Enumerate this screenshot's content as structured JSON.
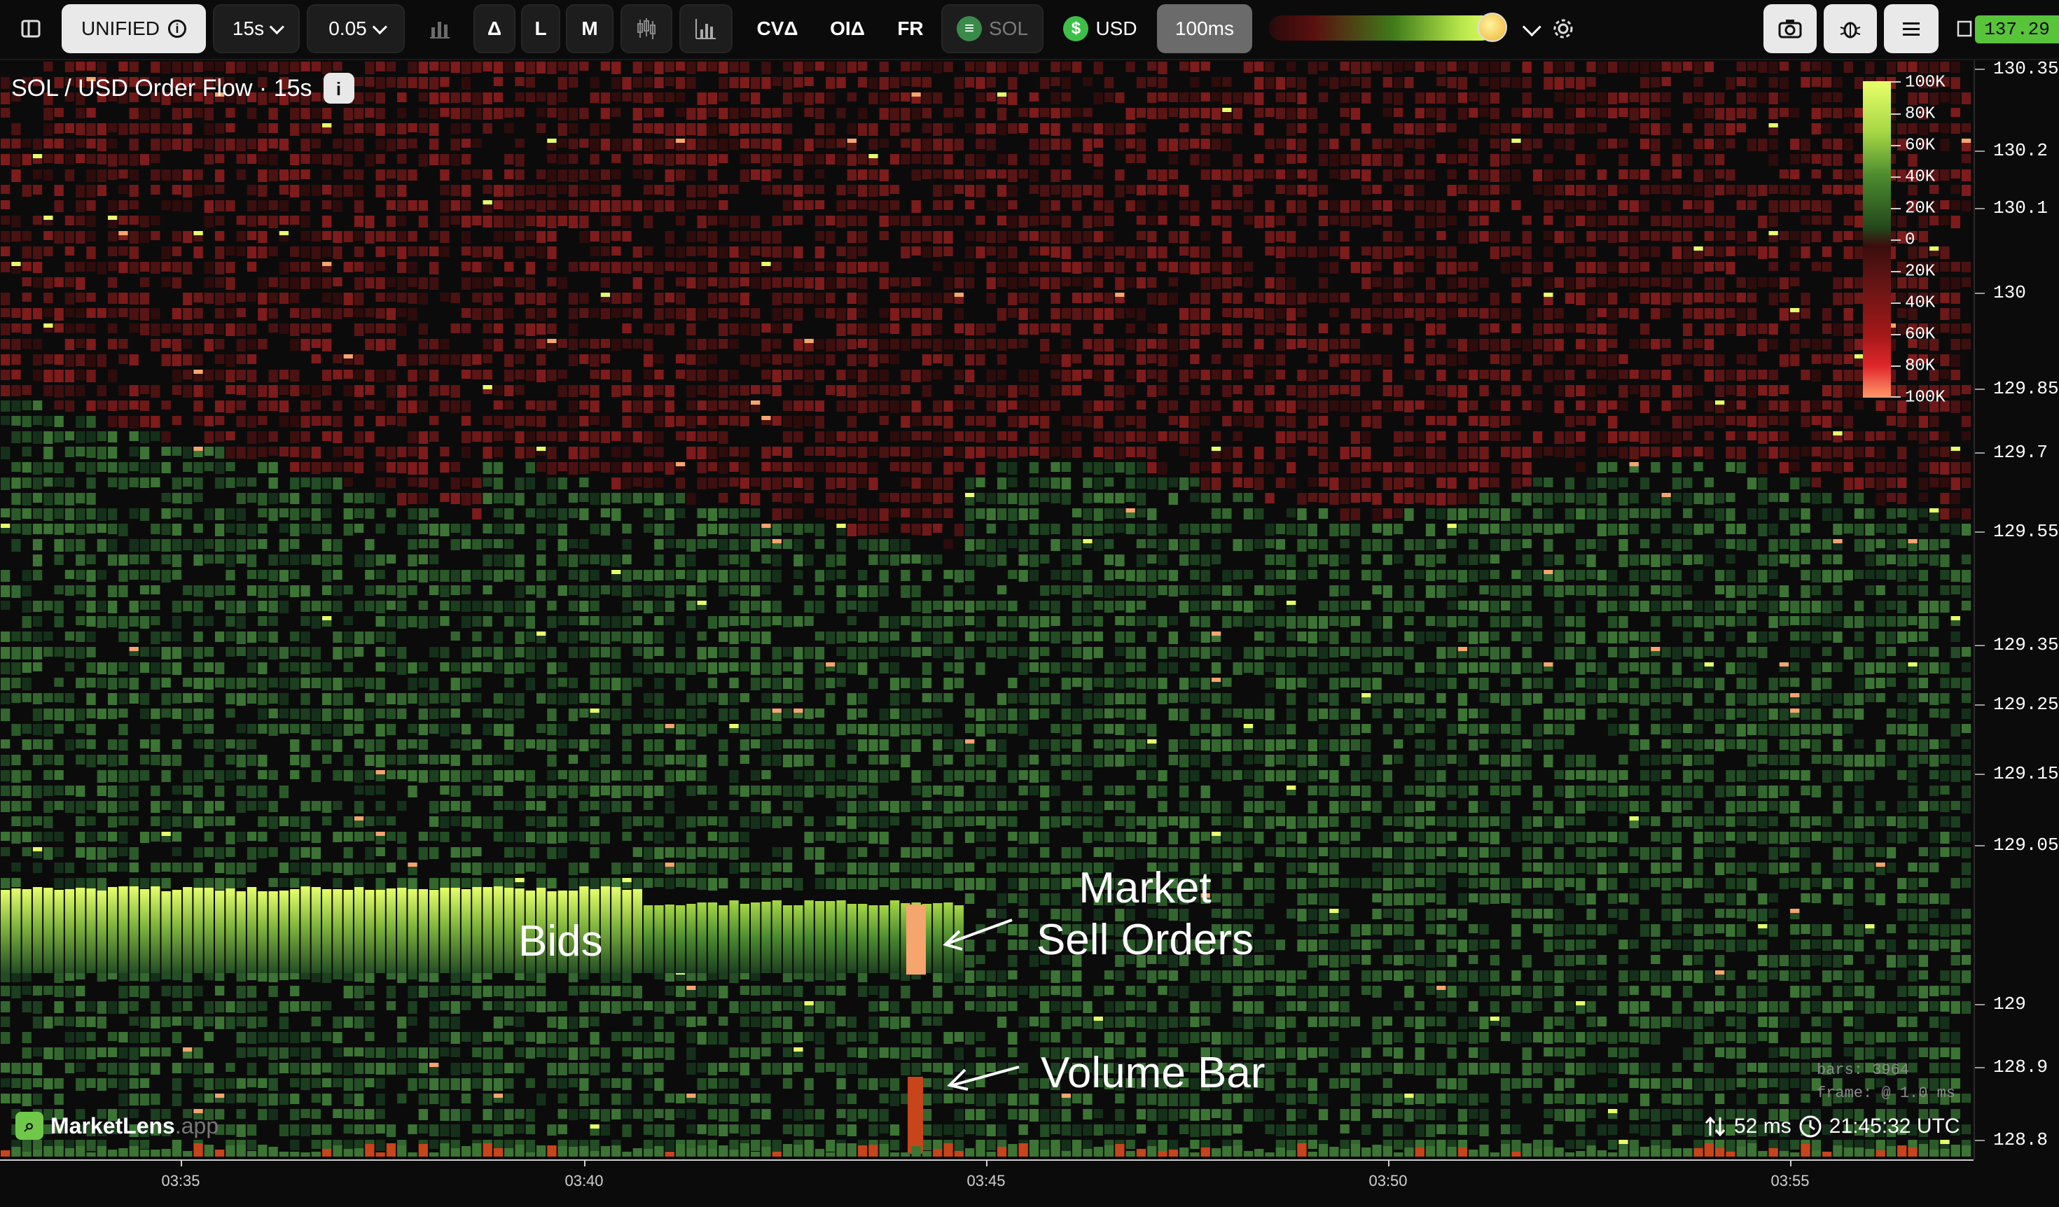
{
  "toolbar": {
    "mode_label": "UNIFIED",
    "interval": "15s",
    "tick_size": "0.05",
    "toggle_delta": "Δ",
    "toggle_l": "L",
    "toggle_m": "M",
    "cvd": "CVΔ",
    "oid": "OIΔ",
    "fr": "FR",
    "base_symbol": "SOL",
    "quote_symbol": "USD",
    "refresh_rate": "100ms",
    "current_price": "137.29",
    "quote_icon": "$",
    "colors": {
      "accent_green": "#58c43a",
      "usd_badge": "#3fbf4a"
    }
  },
  "chart": {
    "title": "SOL / USD Order Flow · 15s",
    "legend_labels": [
      "100K",
      "80K",
      "60K",
      "40K",
      "20K",
      "0",
      "20K",
      "40K",
      "60K",
      "80K",
      "100K"
    ],
    "y_ticks": [
      "130.35",
      "130.2",
      "130.1",
      "130",
      "129.85",
      "129.7",
      "129.55",
      "129.35",
      "129.25",
      "129.15",
      "129.05",
      "129",
      "128.9",
      "128.8"
    ],
    "x_ticks": [
      "03:35",
      "03:40",
      "03:45",
      "03:50",
      "03:55"
    ],
    "annotations": {
      "bids": "Bids",
      "market_sell_line1": "Market",
      "market_sell_line2": "Sell Orders",
      "volume_bar": "Volume Bar"
    },
    "colors": {
      "bid_high": "#e6ff6a",
      "bid_low": "#2e6b27",
      "ask_low": "#3a0d0d",
      "ask_high": "#e0262a",
      "sell_volume": "#f6a56e"
    }
  },
  "watermark": {
    "name": "MarketLens",
    "suffix": ".app"
  },
  "stats": {
    "bars_line": "bars: 3964",
    "frame_line": "frame: @ 1.0 ms"
  },
  "status": {
    "latency": "52 ms",
    "time": "21:45:32 UTC"
  }
}
